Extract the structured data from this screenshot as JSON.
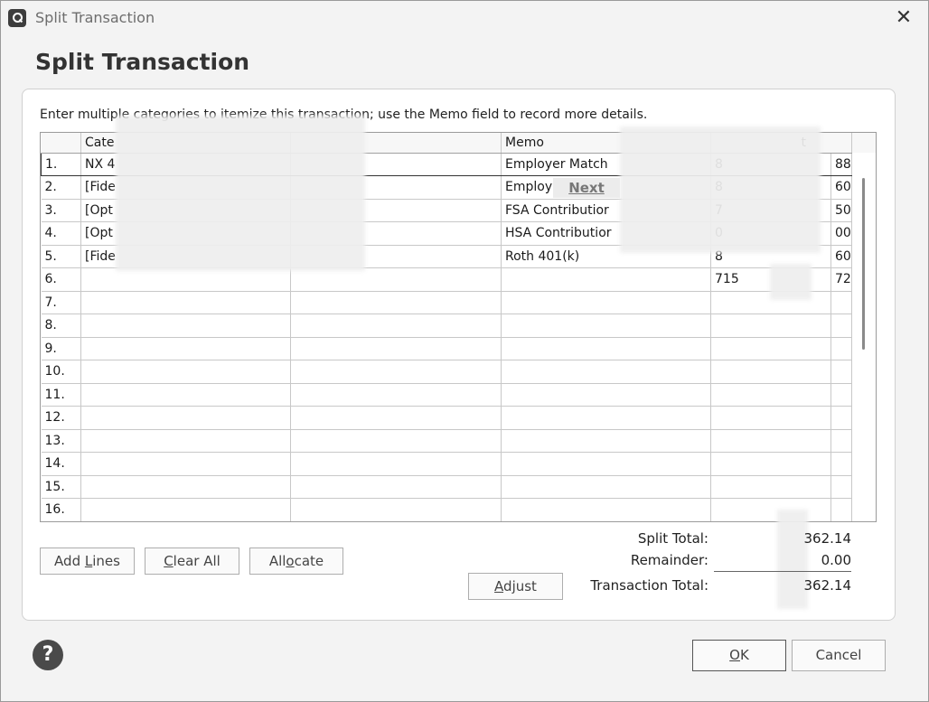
{
  "window": {
    "title": "Split Transaction",
    "heading": "Split Transaction",
    "close_icon": "close-icon",
    "app_icon": "quicken-logo-icon"
  },
  "instructions": "Enter multiple categories to itemize this transaction; use the Memo field to record more details.",
  "grid": {
    "columns": [
      "",
      "Cate",
      "",
      "Memo",
      "t"
    ],
    "rows": [
      {
        "num": "1.",
        "category": "NX 4",
        "tag": "",
        "memo": "Employer Match",
        "amount": "8",
        "cents": "88"
      },
      {
        "num": "2.",
        "category": "[Fide",
        "tag": "",
        "memo": "Employ",
        "amount": "8",
        "cents": "60"
      },
      {
        "num": "3.",
        "category": "[Opt",
        "tag": "",
        "memo": "FSA Contributior",
        "amount": "7",
        "cents": "50"
      },
      {
        "num": "4.",
        "category": "[Opt",
        "tag": "",
        "memo": "HSA Contributior",
        "amount": "0",
        "cents": "00"
      },
      {
        "num": "5.",
        "category": "[Fide",
        "tag": "",
        "memo": "Roth 401(k)",
        "amount": "8",
        "cents": "60"
      },
      {
        "num": "6.",
        "category": "",
        "tag": "",
        "memo": "",
        "amount": "715",
        "cents": "72"
      },
      {
        "num": "7.",
        "category": "",
        "tag": "",
        "memo": "",
        "amount": "",
        "cents": ""
      },
      {
        "num": "8.",
        "category": "",
        "tag": "",
        "memo": "",
        "amount": "",
        "cents": ""
      },
      {
        "num": "9.",
        "category": "",
        "tag": "",
        "memo": "",
        "amount": "",
        "cents": ""
      },
      {
        "num": "10.",
        "category": "",
        "tag": "",
        "memo": "",
        "amount": "",
        "cents": ""
      },
      {
        "num": "11.",
        "category": "",
        "tag": "",
        "memo": "",
        "amount": "",
        "cents": ""
      },
      {
        "num": "12.",
        "category": "",
        "tag": "",
        "memo": "",
        "amount": "",
        "cents": ""
      },
      {
        "num": "13.",
        "category": "",
        "tag": "",
        "memo": "",
        "amount": "",
        "cents": ""
      },
      {
        "num": "14.",
        "category": "",
        "tag": "",
        "memo": "",
        "amount": "",
        "cents": ""
      },
      {
        "num": "15.",
        "category": "",
        "tag": "",
        "memo": "",
        "amount": "",
        "cents": ""
      },
      {
        "num": "16.",
        "category": "",
        "tag": "",
        "memo": "",
        "amount": "",
        "cents": ""
      }
    ],
    "next_hint": "Next"
  },
  "buttons": {
    "add_lines": {
      "pre": "Add ",
      "underline": "L",
      "post": "ines"
    },
    "clear_all": {
      "pre": "",
      "underline": "C",
      "post": "lear All"
    },
    "allocate": {
      "pre": "All",
      "underline": "o",
      "post": "cate"
    },
    "adjust": {
      "pre": "",
      "underline": "A",
      "post": "djust"
    },
    "ok": {
      "pre": "",
      "underline": "O",
      "post": "K"
    },
    "cancel": "Cancel"
  },
  "totals": {
    "split_total_label": "Split Total:",
    "split_total_value": "362.14",
    "remainder_label": "Remainder:",
    "remainder_value": "0.00",
    "transaction_total_label": "Transaction Total:",
    "transaction_total_value": "362.14"
  },
  "help_icon": "?"
}
